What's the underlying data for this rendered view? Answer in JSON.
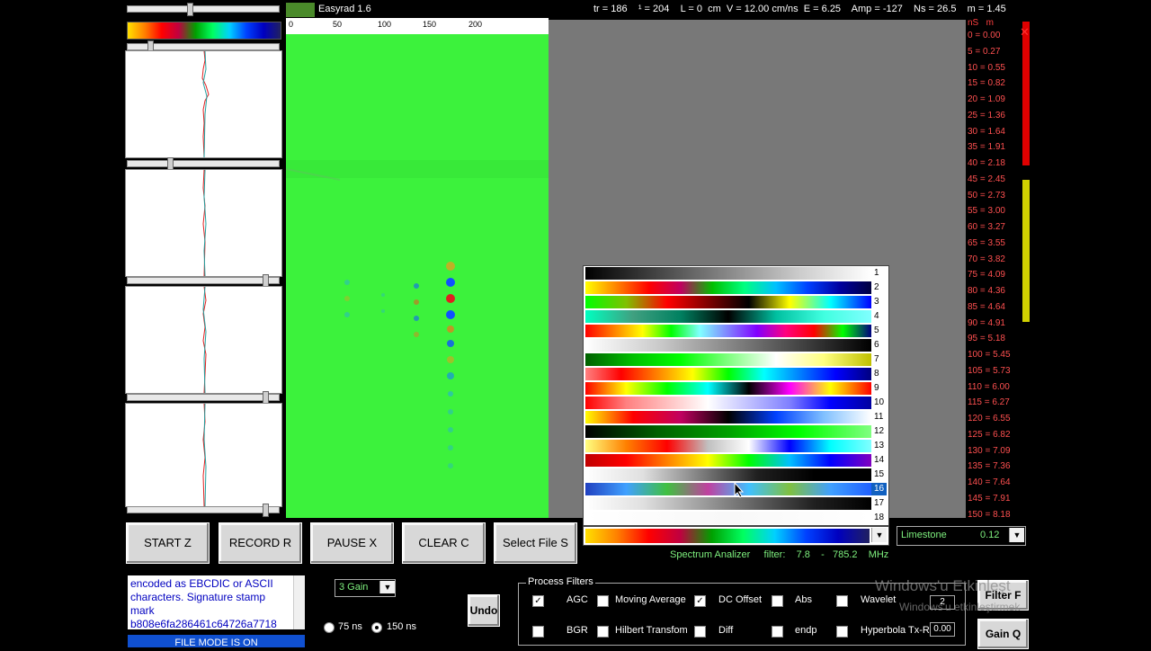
{
  "app": {
    "title": "Easyrad 1.6"
  },
  "info_bar": {
    "text": "tr = 186    ¹ = 204    L = 0  cm  V = 12.00 cm/ns  E = 6.25    Amp = -127    Ns = 26.5    m = 1.45"
  },
  "ruler": {
    "ticks": [
      "0",
      "50",
      "100",
      "150",
      "200"
    ]
  },
  "depth_scale": {
    "header_ns": "nS",
    "header_m": "m",
    "rows": [
      "0 = 0.00",
      "5 = 0.27",
      "10 = 0.55",
      "15 = 0.82",
      "20 = 1.09",
      "25 = 1.36",
      "30 = 1.64",
      "35 = 1.91",
      "40 = 2.18",
      "45 = 2.45",
      "50 = 2.73",
      "55 = 3.00",
      "60 = 3.27",
      "65 = 3.55",
      "70 = 3.82",
      "75 = 4.09",
      "80 = 4.36",
      "85 = 4.64",
      "90 = 4.91",
      "95 = 5.18",
      "100 = 5.45",
      "105 = 5.73",
      "110 = 6.00",
      "115 = 6.27",
      "120 = 6.55",
      "125 = 6.82",
      "130 = 7.09",
      "135 = 7.36",
      "140 = 7.64",
      "145 = 7.91",
      "150 = 8.18"
    ]
  },
  "palette": {
    "selected": "16",
    "items": [
      {
        "num": "1",
        "gradient": "linear-gradient(90deg,#000,#444,#888,#ccc,#fff)"
      },
      {
        "num": "2",
        "gradient": "linear-gradient(90deg,#ffff00,#ff8000,#ff0000,#c00060,#00c000,#00ff80,#00c0ff,#0040ff,#0000a0,#000040)"
      },
      {
        "num": "3",
        "gradient": "linear-gradient(90deg,#00ff00,#80c000,#ff0000,#800000,#000000,#ffff00,#00ffff,#0000ff)"
      },
      {
        "num": "4",
        "gradient": "linear-gradient(90deg,#00ffc0,#40a080,#008060,#000000,#00c0a0,#40ffe0,#80ffff)"
      },
      {
        "num": "5",
        "gradient": "linear-gradient(90deg,#ff0000,#ff8000,#ffff00,#00ff00,#80ffff,#8080ff,#8000ff,#ff0080,#ff0000,#00ff00,#000080)"
      },
      {
        "num": "6",
        "gradient": "linear-gradient(90deg,#fff,#ccc,#888,#444,#000)"
      },
      {
        "num": "7",
        "gradient": "linear-gradient(90deg,#006000,#00c000,#00ff00,#80ff80,#ffffff,#ffff80,#c0c000)"
      },
      {
        "num": "8",
        "gradient": "linear-gradient(90deg,#ff8080,#ff0000,#ff8000,#ffff00,#00ff00,#00ffff,#0080ff,#0000ff,#000080)"
      },
      {
        "num": "9",
        "gradient": "linear-gradient(90deg,#ff0000,#ffff00,#00ff00,#00ffff,#000000,#ff00ff,#ffff00,#ff0000)"
      },
      {
        "num": "10",
        "gradient": "linear-gradient(90deg,#ff0000,#ff8080,#ffc0c0,#ffffff,#c0c0ff,#8080ff,#0000ff,#0000a0)"
      },
      {
        "num": "11",
        "gradient": "linear-gradient(90deg,#ffff00,#ff0000,#c00060,#000000,#0040ff,#80c0ff,#ffffff)"
      },
      {
        "num": "12",
        "gradient": "linear-gradient(90deg,#000000,#006000,#00a000,#00ff00,#80ff80)"
      },
      {
        "num": "13",
        "gradient": "linear-gradient(90deg,#ffff80,#ff8000,#ff0000,#c0c0c0,#ffffff,#0000ff,#00ffff,#80ffff)"
      },
      {
        "num": "14",
        "gradient": "linear-gradient(90deg,#c00000,#ff0000,#ff8000,#ffff00,#00ff00,#00c0ff,#0000ff,#8000c0)"
      },
      {
        "num": "15",
        "gradient": "linear-gradient(90deg,#ffffff,#e0e0e0,#808080,#202020,#000000,#000000)"
      },
      {
        "num": "16",
        "gradient": "linear-gradient(90deg,#2040c0,#40a0ff,#40c040,#c040a0,#40c0ff,#80c040,#40a0ff,#2060ff)"
      },
      {
        "num": "17",
        "gradient": "linear-gradient(90deg,#ffffff,#e0e0e0,#a0a0a0,#606060,#202020,#000000)"
      },
      {
        "num": "18",
        "gradient": "linear-gradient(90deg,#ffffff,#f8f8f8,#ffffff)"
      }
    ]
  },
  "material": {
    "name": "Limestone",
    "value": "0.12"
  },
  "spectrum": {
    "text": "Spectrum Analizer     filter:    7.8    -   785.2    MHz"
  },
  "buttons": {
    "start": "START  Z",
    "record": "RECORD  R",
    "pause": "PAUSE  X",
    "clear": "CLEAR  C",
    "select_file": "Select File  S",
    "undo": "Undo",
    "filter": "Filter  F",
    "gain": "Gain  Q"
  },
  "notes": {
    "text": "encoded as EBCDIC or ASCII characters. Signature stamp mark\nb808e6fa286461c64726a7718"
  },
  "file_mode": "FILE  MODE IS  ON",
  "gain_select": "3 Gain",
  "timebase": {
    "opt1": "75 ns",
    "opt2": "150 ns"
  },
  "process_filters": {
    "legend": "Process Filters",
    "row1": [
      {
        "label": "AGC",
        "checked": true
      },
      {
        "label": "Moving Average",
        "checked": false
      },
      {
        "label": "DC Offset",
        "checked": true
      },
      {
        "label": "Abs",
        "checked": false
      },
      {
        "label": "Wavelet",
        "checked": false
      }
    ],
    "row2": [
      {
        "label": "BGR",
        "checked": false
      },
      {
        "label": "Hilbert Transfom",
        "checked": false
      },
      {
        "label": "Diff",
        "checked": false
      },
      {
        "label": "endp",
        "checked": false
      },
      {
        "label": "Hyperbola Tx-Rx",
        "checked": false
      }
    ],
    "wavelet_value": "2",
    "hyperbola_value": "0.00"
  },
  "watermark": {
    "line1": "Windows'u Etkinleşt",
    "line2": "Windows'u etkinleştirmek"
  }
}
